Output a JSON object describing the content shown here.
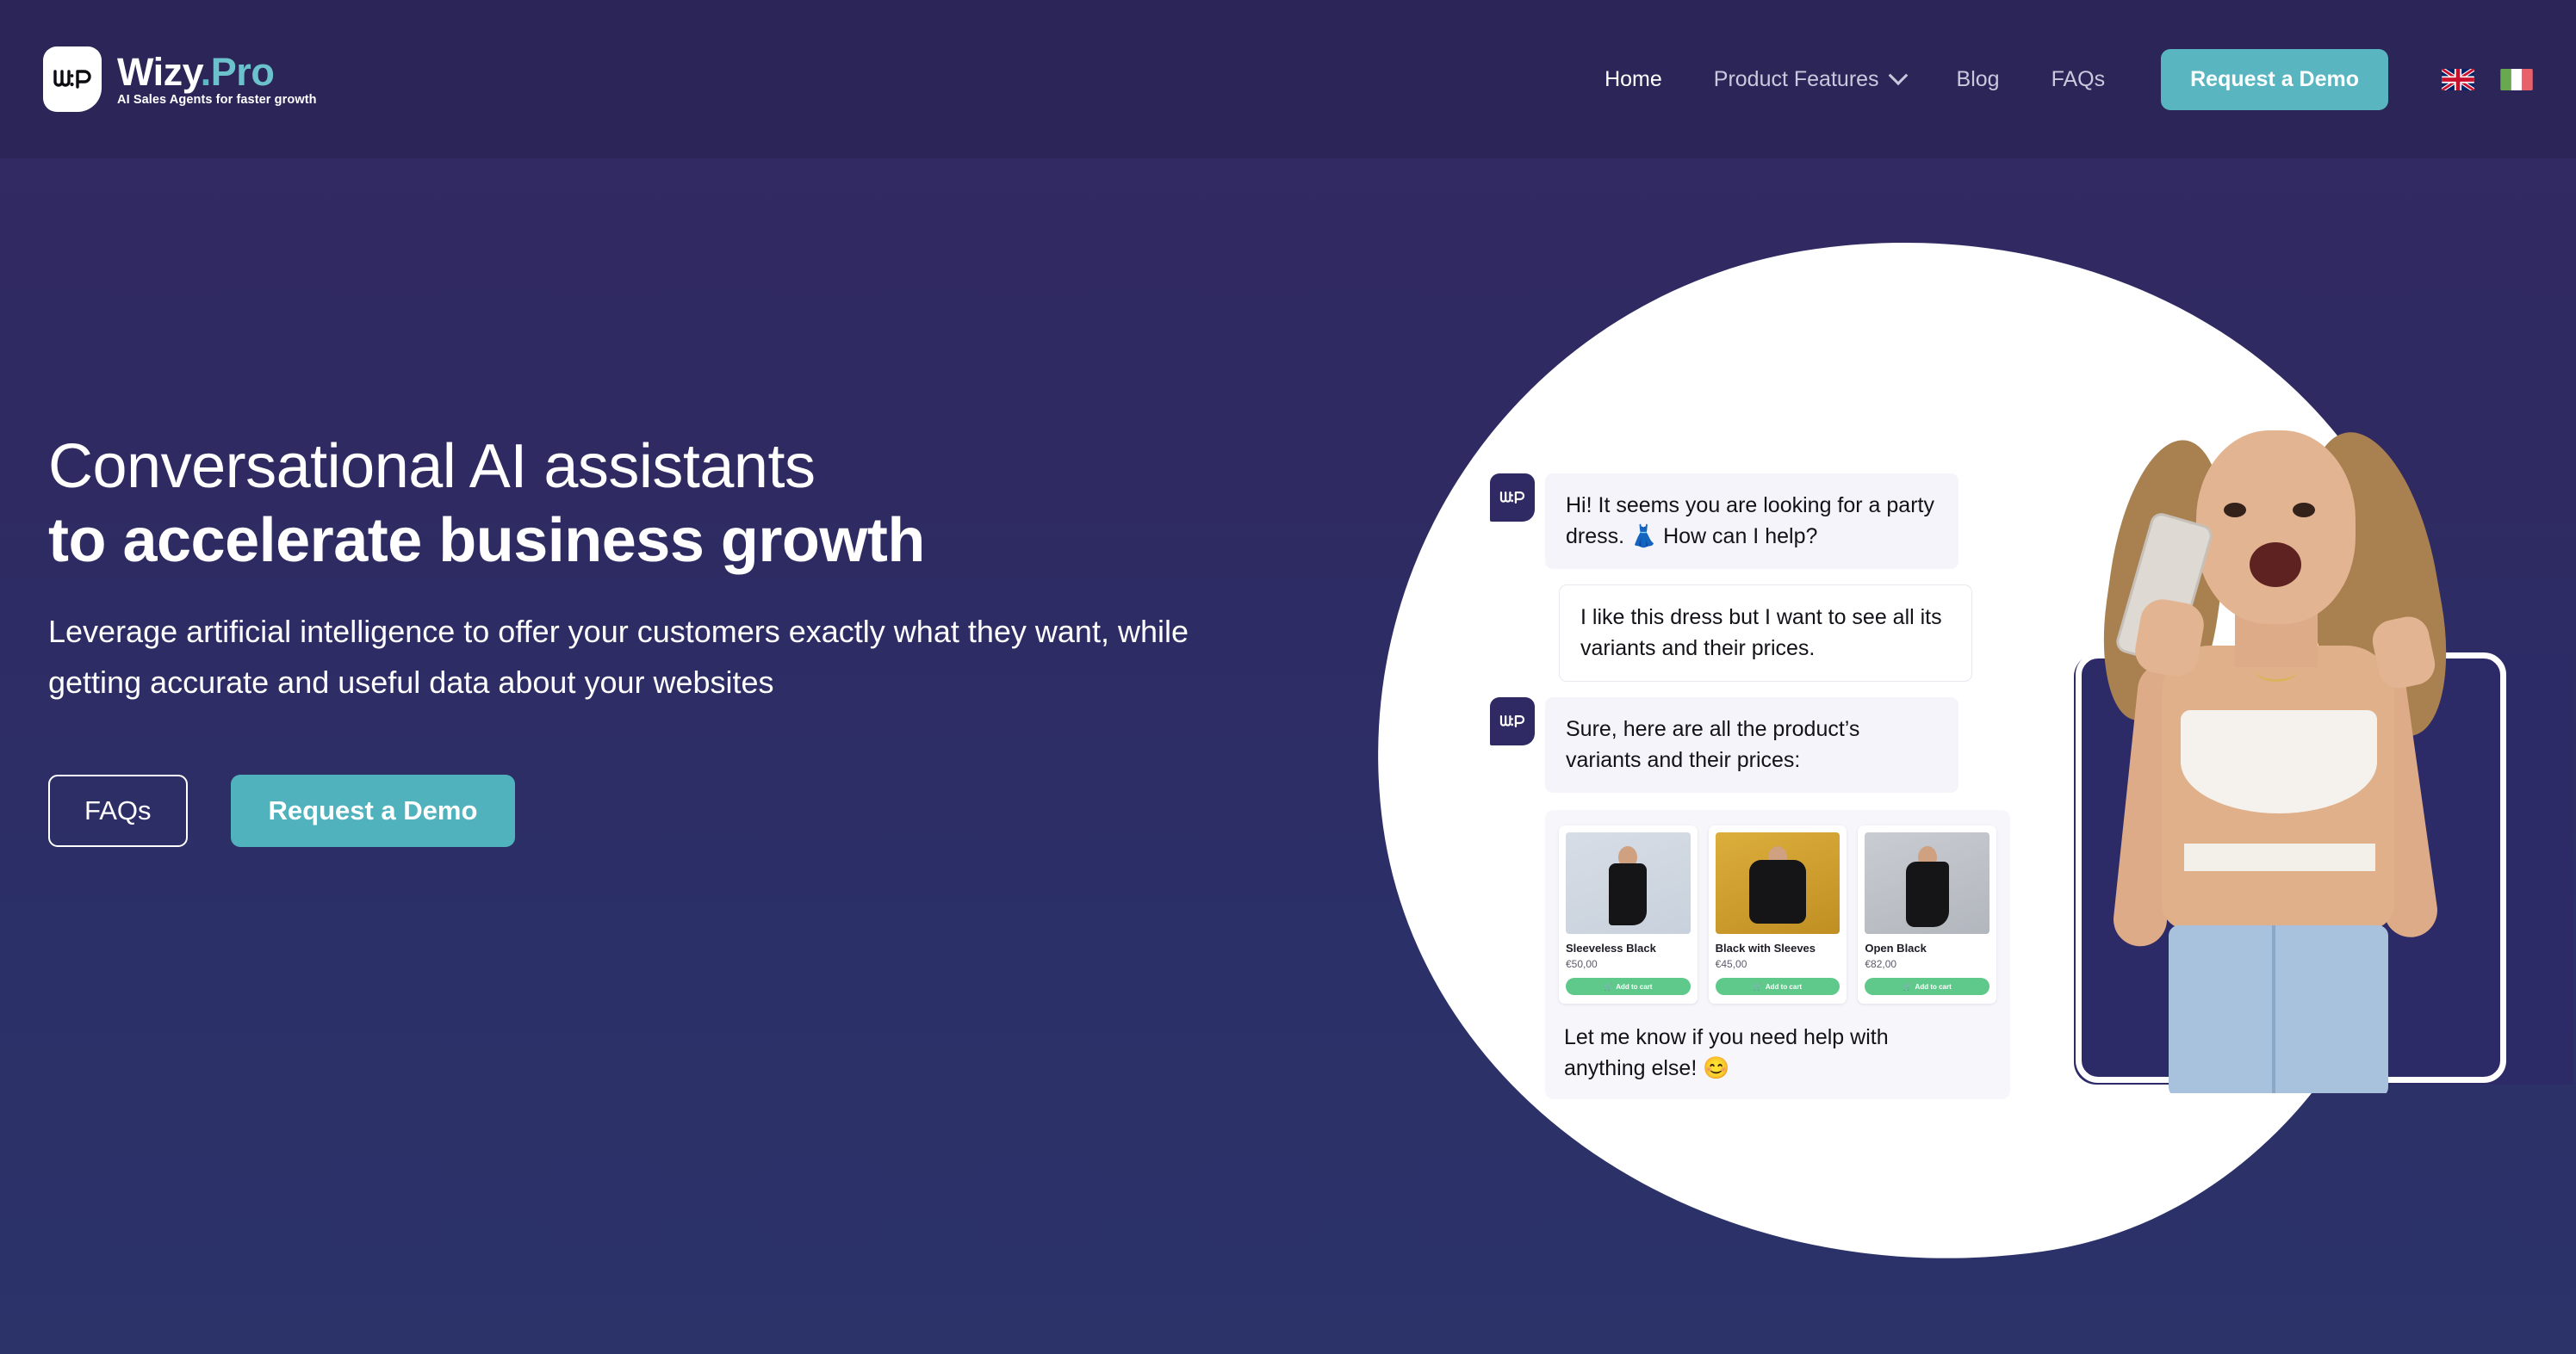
{
  "header": {
    "logo": {
      "mark_icon": "wizy-logo-mark-icon",
      "name_first": "Wizy",
      "name_dot": ".",
      "name_second": "Pro",
      "tagline": "AI Sales Agents for faster growth"
    },
    "nav": [
      {
        "label": "Home",
        "active": true,
        "has_dropdown": false
      },
      {
        "label": "Product Features",
        "active": false,
        "has_dropdown": true
      },
      {
        "label": "Blog",
        "active": false,
        "has_dropdown": false
      },
      {
        "label": "FAQs",
        "active": false,
        "has_dropdown": false
      }
    ],
    "cta_label": "Request a Demo",
    "flags": [
      {
        "name": "united-kingdom-flag-icon",
        "alt": "English"
      },
      {
        "name": "italy-flag-icon",
        "alt": "Italiano"
      }
    ]
  },
  "hero": {
    "headline_light": "Conversational AI assistants",
    "headline_bold": "to accelerate business growth",
    "subtitle": "Leverage artificial intelligence to offer your customers exactly what they want, while getting accurate and useful data about your websites",
    "cta_secondary": "FAQs",
    "cta_primary": "Request a Demo"
  },
  "chat": {
    "messages": [
      {
        "sender": "bot",
        "text": "Hi! It seems you are looking for a party dress. 👗 How can I help?"
      },
      {
        "sender": "user",
        "text": "I like this dress but I want to see all its variants and their prices."
      },
      {
        "sender": "bot",
        "text": "Sure, here are all the product’s variants and their prices:"
      },
      {
        "sender": "bot",
        "text": "Let me know if you need help with anything else! 😊"
      }
    ],
    "products": [
      {
        "name": "Sleeveless Black",
        "price": "€50,00",
        "button": "Add to cart"
      },
      {
        "name": "Black with Sleeves",
        "price": "€45,00",
        "button": "Add to cart"
      },
      {
        "name": "Open Black",
        "price": "€82,00",
        "button": "Add to cart"
      }
    ]
  },
  "colors": {
    "header_bg": "#2c2558",
    "body_top": "#332a63",
    "body_bottom": "#2b3369",
    "accent_teal": "#59b6c0",
    "logo_pro": "#6cc2cc",
    "cart_green": "#5ec98a",
    "bubble_bot": "#f4f4fa"
  }
}
